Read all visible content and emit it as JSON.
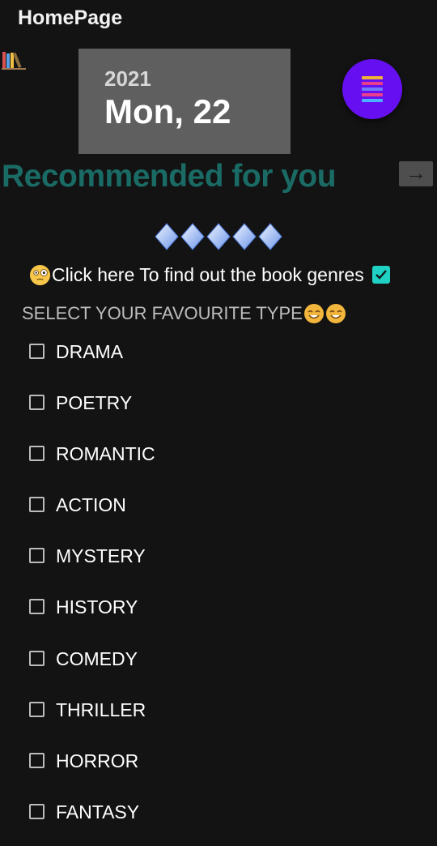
{
  "app": {
    "title": "HomePage"
  },
  "date_card": {
    "year": "2021",
    "day": "Mon, 22"
  },
  "menu_fab": {
    "icon": "menu-lines-icon",
    "color": "#6610f2",
    "bar_colors": [
      "#f2b233",
      "#e83e8c",
      "#6f7cff",
      "#e83e8c",
      "#4ab0ff"
    ]
  },
  "recommended": {
    "heading": "Recommended for you",
    "arrow_symbol": "→",
    "accent": "#1a6b65"
  },
  "genre_toggle": {
    "label": "Click here To find out the book genres",
    "checked": true,
    "check_color": "#1fd1c2"
  },
  "select_heading": {
    "label": "SELECT YOUR FAVOURITE TYPE"
  },
  "genres": [
    {
      "label": "DRAMA",
      "checked": false
    },
    {
      "label": "POETRY",
      "checked": false
    },
    {
      "label": "ROMANTIC",
      "checked": false
    },
    {
      "label": "ACTION",
      "checked": false
    },
    {
      "label": "MYSTERY",
      "checked": false
    },
    {
      "label": "HISTORY",
      "checked": false
    },
    {
      "label": "COMEDY",
      "checked": false
    },
    {
      "label": "THRILLER",
      "checked": false
    },
    {
      "label": "HORROR",
      "checked": false
    },
    {
      "label": "FANTASY",
      "checked": false
    }
  ]
}
